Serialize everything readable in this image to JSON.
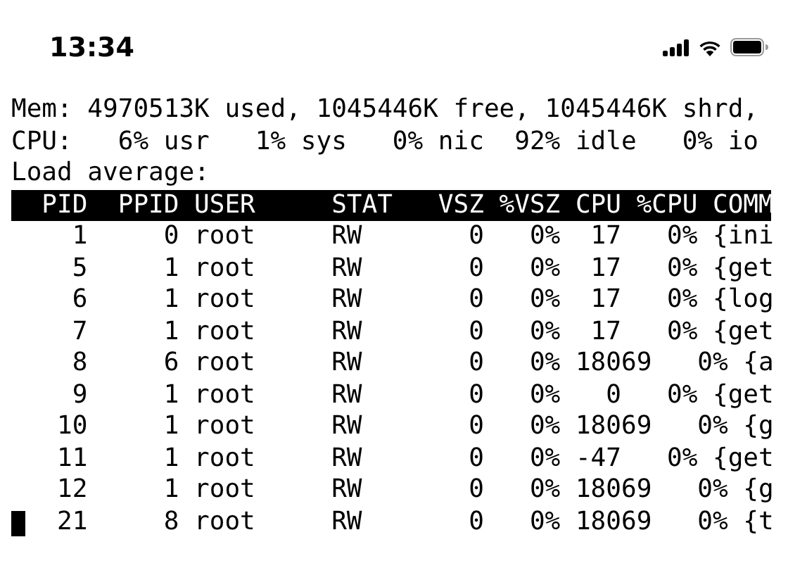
{
  "status_bar": {
    "time": "13:34"
  },
  "terminal": {
    "lines": [
      "Mem: 4970513K used, 1045446K free, 1045446K shrd,",
      "CPU:   6% usr   1% sys   0% nic  92% idle   0% io",
      "Load average:"
    ],
    "header": "  PID  PPID USER     STAT   VSZ %VSZ CPU %CPU COMM",
    "rows": [
      {
        "text": "    1     0 root     RW       0   0%  17   0% {ini",
        "cursor": false
      },
      {
        "text": "    5     1 root     RW       0   0%  17   0% {get",
        "cursor": false
      },
      {
        "text": "    6     1 root     RW       0   0%  17   0% {log",
        "cursor": false
      },
      {
        "text": "    7     1 root     RW       0   0%  17   0% {get",
        "cursor": false
      },
      {
        "text": "    8     6 root     RW       0   0% 18069   0% {a",
        "cursor": false
      },
      {
        "text": "    9     1 root     RW       0   0%   0   0% {get",
        "cursor": false
      },
      {
        "text": "   10     1 root     RW       0   0% 18069   0% {g",
        "cursor": false
      },
      {
        "text": "   11     1 root     RW       0   0% -47   0% {get",
        "cursor": false
      },
      {
        "text": "   12     1 root     RW       0   0% 18069   0% {g",
        "cursor": false
      },
      {
        "text": "   21     8 root     RW       0   0% 18069   0% {t",
        "cursor": true
      }
    ]
  }
}
